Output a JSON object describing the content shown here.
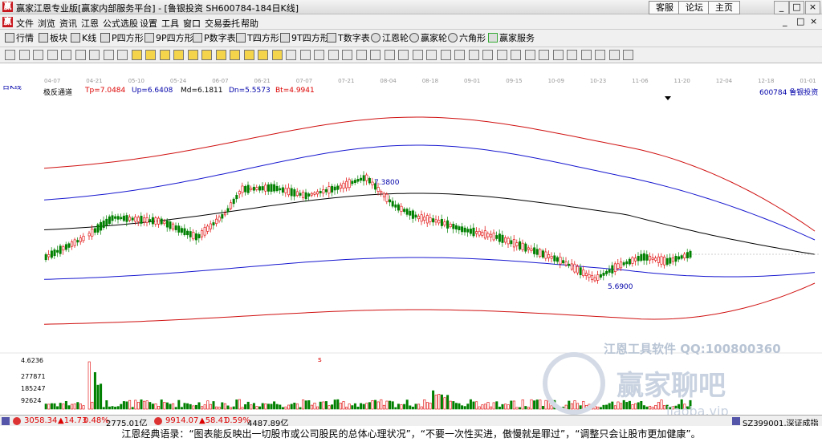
{
  "window": {
    "title": "赢家江恩专业版[赢家内部服务平台] - [鲁银投资  SH600784-184日K线]",
    "links": [
      "客服",
      "论坛",
      "主页"
    ],
    "controls": [
      "_",
      "□",
      "×"
    ]
  },
  "menu": {
    "items": [
      "文件",
      "浏览",
      "资讯",
      "江恩",
      "公式选股",
      "设置",
      "工具",
      "窗口",
      "交易委托",
      "帮助"
    ],
    "right_controls": [
      "_",
      "□",
      "×"
    ]
  },
  "toolbar": {
    "items": [
      "行情",
      "板块",
      "K线",
      "P四方形",
      "9P四方形",
      "P数字表",
      "T四方形",
      "9T四方形",
      "T数字表",
      "江恩轮",
      "赢家轮",
      "六角形",
      "赢家服务"
    ]
  },
  "chart_header": {
    "period": "日K线",
    "indicator": "极反通道",
    "tp": "Tp=7.0484",
    "up": "Up=6.6408",
    "md": "Md=6.1811",
    "dn": "Dn=5.5573",
    "bt": "Bt=4.9941",
    "stock": "600784  鲁银投资"
  },
  "date_ticks": [
    "04-07",
    "04-21",
    "05-10",
    "05-24",
    "06-07",
    "06-21",
    "07-07",
    "07-21",
    "08-04",
    "08-18",
    "09-01",
    "09-15",
    "10-09",
    "10-23",
    "11-06",
    "11-20",
    "12-04",
    "12-18",
    "01-01"
  ],
  "annotations": {
    "high": "7.3800",
    "low": "5.6900",
    "mark_s": "s"
  },
  "volume_axis": [
    "4.6236",
    "277871",
    "185247",
    "92624"
  ],
  "watermark": {
    "line1": "江恩工具软件   QQ:100800360",
    "brand": "赢家聊吧",
    "url": "liaoba.vip"
  },
  "colors": {
    "up": "#e00000",
    "down": "#008000",
    "upper_band": "#d01010",
    "mid_band": "#1818d0",
    "middle": "#000000"
  },
  "statusbar": {
    "sh_index": "3058.34",
    "sh_change": "▲14.73",
    "sh_pct": "0.48%",
    "sh_amount": "2775.01亿",
    "sz_index": "9914.07",
    "sz_change": "▲58.41",
    "sz_pct": "0.59%",
    "sz_amount": "4487.89亿",
    "ticker": "SZ399001,深证成指"
  },
  "quote": "江恩经典语录：“图表能反映出一切股市或公司股民的总体心理状况”，“不要一次性买进，傲慢就是罪过”，“调整只会让股市更加健康”。"
}
